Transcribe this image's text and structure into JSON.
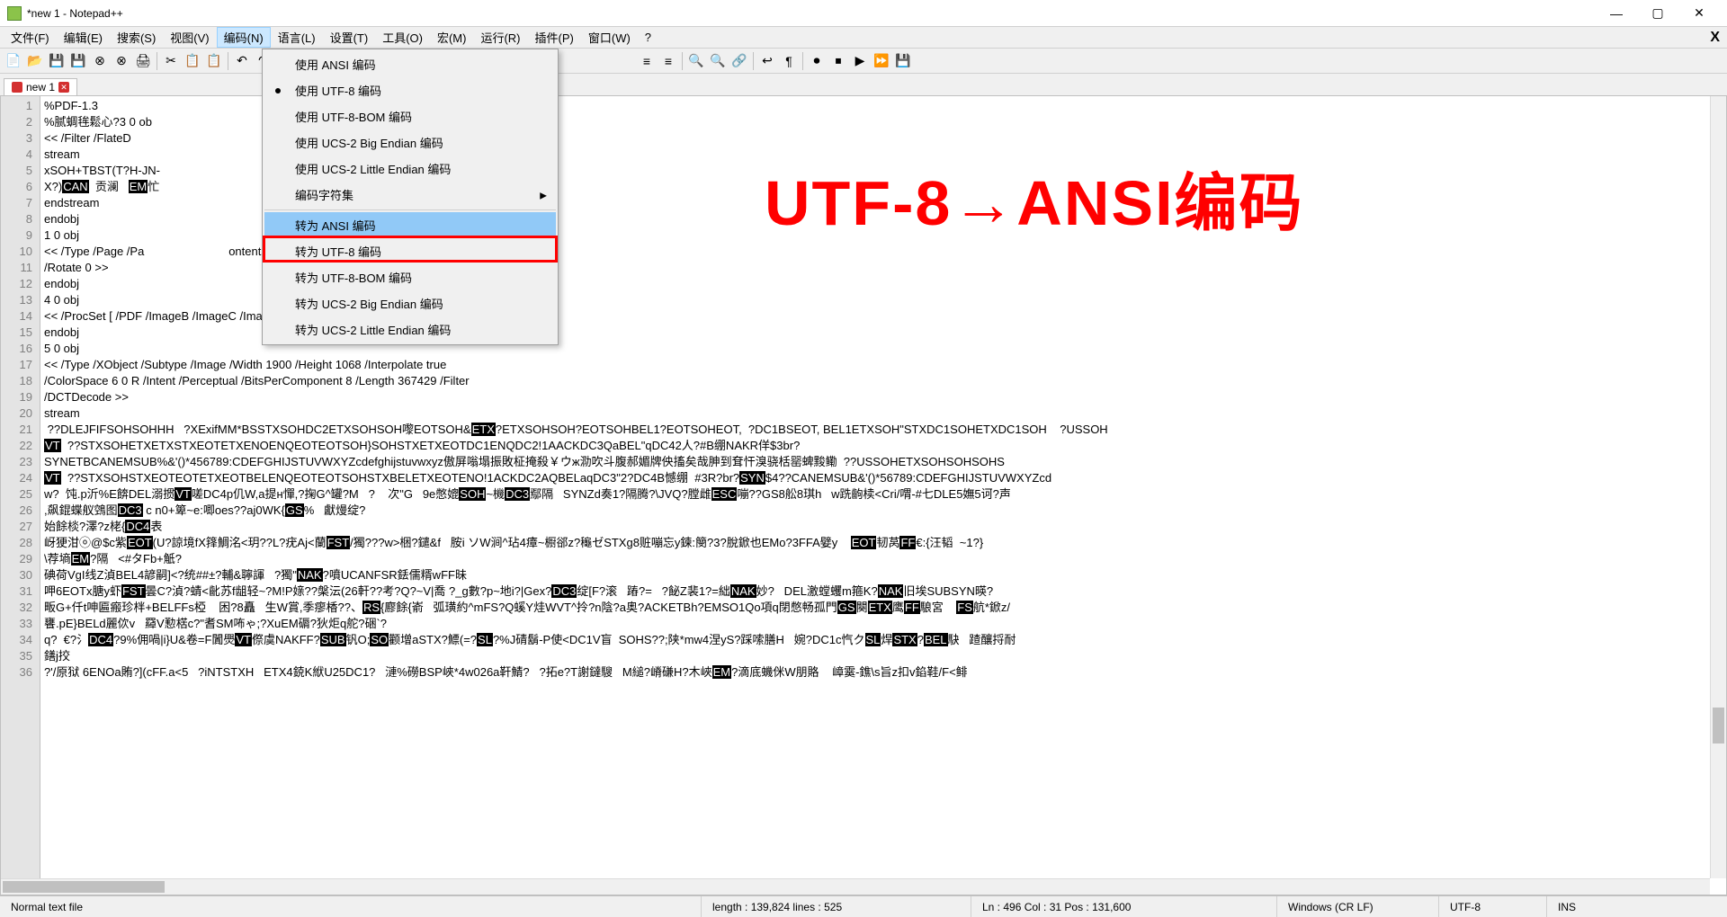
{
  "window": {
    "title": "*new 1 - Notepad++"
  },
  "menubar": {
    "items": [
      "文件(F)",
      "编辑(E)",
      "搜索(S)",
      "视图(V)",
      "编码(N)",
      "语言(L)",
      "设置(T)",
      "工具(O)",
      "宏(M)",
      "运行(R)",
      "插件(P)",
      "窗口(W)",
      "?"
    ],
    "active_index": 4
  },
  "dropdown": {
    "items": [
      {
        "label": "使用 ANSI 编码",
        "checked": false
      },
      {
        "label": "使用 UTF-8 编码",
        "checked": true
      },
      {
        "label": "使用 UTF-8-BOM 编码",
        "checked": false
      },
      {
        "label": "使用 UCS-2 Big Endian 编码",
        "checked": false
      },
      {
        "label": "使用 UCS-2 Little Endian 编码",
        "checked": false
      },
      {
        "label": "编码字符集",
        "submenu": true,
        "sep_after": true
      },
      {
        "label": "转为 ANSI 编码",
        "highlighted": true
      },
      {
        "label": "转为 UTF-8 编码"
      },
      {
        "label": "转为 UTF-8-BOM 编码"
      },
      {
        "label": "转为 UCS-2 Big Endian 编码"
      },
      {
        "label": "转为 UCS-2 Little Endian 编码"
      }
    ]
  },
  "tab": {
    "name": "new 1"
  },
  "overlay": "UTF-8→ANSI编码",
  "code_lines": [
    "%PDF-1.3",
    "%腻蜩毪鬆心?3 0 ob",
    "<< /Filter /FlateD",
    "stream",
    "xSOH+TBST(T?H-JN-",
    "X?)CAN  贡澜   EM忙",
    "endstream",
    "endobj",
    "1 0 obj",
    "<< /Type /Page /Pa                          ontents 3 0 R /MediaBox [0 0 842 595]",
    "/Rotate 0 >>",
    "endobj",
    "4 0 obj",
    "<< /ProcSet [ /PDF /ImageB /ImageC /ImageI ] /XObject << /Im1 5 0 R >> >>",
    "endobj",
    "5 0 obj",
    "<< /Type /XObject /Subtype /Image /Width 1900 /Height 1068 /Interpolate true",
    "/ColorSpace 6 0 R /Intent /Perceptual /BitsPerComponent 8 /Length 367429 /Filter",
    "/DCTDecode >>",
    "stream",
    " ??DLEJFIFSOHSOHHH   ?XExifMM*BSSTXSOHDC2ETXSOHSOH嚟EOTSOH&ETX?ETXSOHSOH?EOTSOHBEL1?EOTSOHEOT,  ?DC1BSEOT, BEL1ETXSOH\"STXDC1SOHETXDC1SOH    ?USSOH",
    "VT  ??STXSOHETXETXSTXEOTETXENOENQEOTEOTSOH}SOHSTXETXEOTDC1ENQDC2!1AACKDC3QaBEL\"qDC42人?#B绷NAKR佯$3br?",
    "SYNETBCANEMSUB%&'()*456789:CDEFGHIJSTUVWXYZcdefghijstuvwxyz傲屏嗡塌振敗柾掩殺￥ウж泐吹斗腹郝媚牌佒搐矣哉胂到耷忓溴骁栝罂蜱黢鳓  ??USSOHETXSOHSOHSOHS",
    "VT  ??STXSOHSTXEOTEOTETXEOTBELENQEOTEOTSOHSTXBELETXEOTENO!1ACKDC2AQBELaqDC3\"2?DC4B憾绷  #3R?br?SYN$4??CANEMSUB&'()*56789:CDEFGHIJSTUVWXYZcd",
    "w?  饨.p沂%E餴DEL溺掼VT嗟DC4p仉W,a提н憚,?掬G^罐?M   ?    次\"G   9e憋媲SOH~機DC3鄢隔   SYNZd奏1?隔腾?\\JVQ?膛雌ESC嘣??GS8舩8琪h   w跣齣椟<Cri/喟-#七DLE5嫵5诃?声",
    ",飙錕蝶舣鵼图DC3 c n0+箄~e:唧oes??aj0WK{GS%   獻熳绽?",
    "始餘棪?澤?z栳{DC4表",
    "岈㹴泔ⓞ@$c紫EOT(U?諒境fX箨鯛洺<玥??L?疣Aj<蘭FST/獨???w>梱?鑓&f   胺i ソW涧^玷4瘴~櫉郤z?龝ゼSTXg8赃嘣忘y鍊:簢?3?脫鍁也EMo?3FFA嬖y    EOT韧莴FF€:{汪韬  ~1?}",
    "\\荐墒EM?隔   <#タFb+觗?",
    "碘荷VgI线Z湞BEL4諺嗣]<?统##±?輔&聹諢   ?獨\"NAK?噴UCANFSR銩儒糈wFF昧",
    "呷6EOTx膅y虾FST曇C?湞?蜻<齔苏f龃轻~?M!P媇??槃沄(26軒??考?Q?~V|喬 ?_g數?p~地i?|Geх?DC3绽[F?滚   蹖?=   ?飶Z裴1?=絀NAK妙?   DEL激螳蠼m箍K?NAK旧埃SUBSYN暎?",
    "畈G+仟t呻匾瘢珍柈+BELFFs椏    困?8矗   生W賞,季瘳楿??、RS{廫餘{嵛   弧璜約^mFS?Q螇Y烓WVT^拎?n陰?a奥?ACKETBh?EMSO1Qo項q閉憋畅孤門GS闋ETX鹰FF駺宮    FS航*鍁z/",
    "饔.pE}BELd麗佽v   羄V懃楛c?\"耆SM咘ゃ;?XuEM磭?狄炬q舵?硱`?",
    "q?  €?氵DC4?9%佣喎|i}U&卷=F闐爂VT傺虞NAKFF?SUB钒O;SO颧增aSTX?鰾(=?SL?%J碃鬍-P使<DC1V盲  SOHS??;陕*mw4涅yS?踩嗦膳H   婉?DC1c忾クSL焊STX?BEL駃   蹅釀捋耐",
    "鐥j挍",
    "?'/原狱 6ENOa賄?](cFF.a<5   ?iNTSTXH   ETX4鋴K絥U25DC1?   漣%磱BSP峽*4w026a靬鯖?   ?拓e?T謝鐽騪   M縋?嵴磏H?木峽EM?滴底蟣侎W朋賂    嶂霙-鐎\\s旨z扣v錎鞋/F<鲱"
  ],
  "line_start": 1,
  "statusbar": {
    "mode": "Normal text file",
    "length": "length : 139,824    lines : 525",
    "pos": "Ln : 496    Col : 31    Pos : 131,600",
    "eol": "Windows (CR LF)",
    "enc": "UTF-8",
    "ins": "INS"
  }
}
